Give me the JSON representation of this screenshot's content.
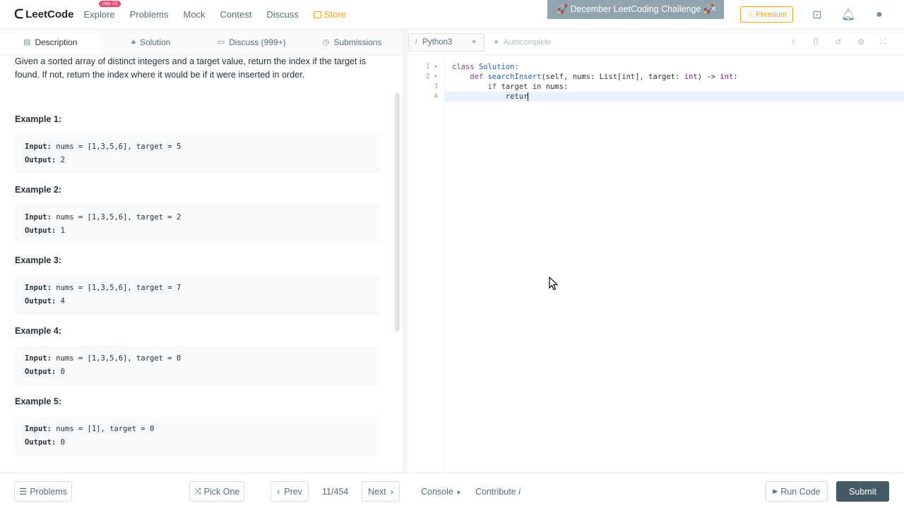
{
  "header": {
    "logo_text": "LeetCode",
    "nav": [
      "Explore",
      "Problems",
      "Mock",
      "Contest",
      "Discuss",
      "Store"
    ],
    "explore_badge": "Day 31",
    "banner": "🚀 December LeetCoding Challenge 🚀",
    "premium": "☆ Premium"
  },
  "left_tabs": [
    "Description",
    "Solution",
    "Discuss (999+)",
    "Submissions"
  ],
  "description": {
    "text": "Given a sorted array of distinct integers and a target value, return the index if the target is found. If not, return the index where it would be if it were inserted in order.",
    "examples": [
      {
        "title": "Example 1:",
        "input": "nums = [1,3,5,6], target = 5",
        "output": "2"
      },
      {
        "title": "Example 2:",
        "input": "nums = [1,3,5,6], target = 2",
        "output": "1"
      },
      {
        "title": "Example 3:",
        "input": "nums = [1,3,5,6], target = 7",
        "output": "4"
      },
      {
        "title": "Example 4:",
        "input": "nums = [1,3,5,6], target = 0",
        "output": "0"
      },
      {
        "title": "Example 5:",
        "input": "nums = [1], target = 0",
        "output": "0"
      }
    ],
    "input_label": "Input:",
    "output_label": "Output:"
  },
  "editor": {
    "language": "Python3",
    "autocomplete": "Autocomplete",
    "gutter": [
      "1 ▾",
      "2 ▾",
      "3",
      "4"
    ],
    "code": {
      "l1_kw": "class",
      "l1_name": "Solution:",
      "l2_kw": "def",
      "l2_fn": "searchInsert",
      "l2_open": "(",
      "l2_self": "self, nums: List[",
      "l2_int1": "int",
      "l2_mid": "], target: ",
      "l2_int2": "int",
      "l2_arrow": ") -> ",
      "l2_int3": "int",
      "l2_colon": ":",
      "l3_kw": "if",
      "l3_rest": "target in nums:",
      "l4": "retur"
    }
  },
  "footer": {
    "problems": "Problems",
    "pick_one": "Pick One",
    "prev": "Prev",
    "counter": "11/454",
    "next": "Next",
    "console": "Console",
    "contribute": "Contribute",
    "run_code": "Run Code",
    "submit": "Submit"
  }
}
